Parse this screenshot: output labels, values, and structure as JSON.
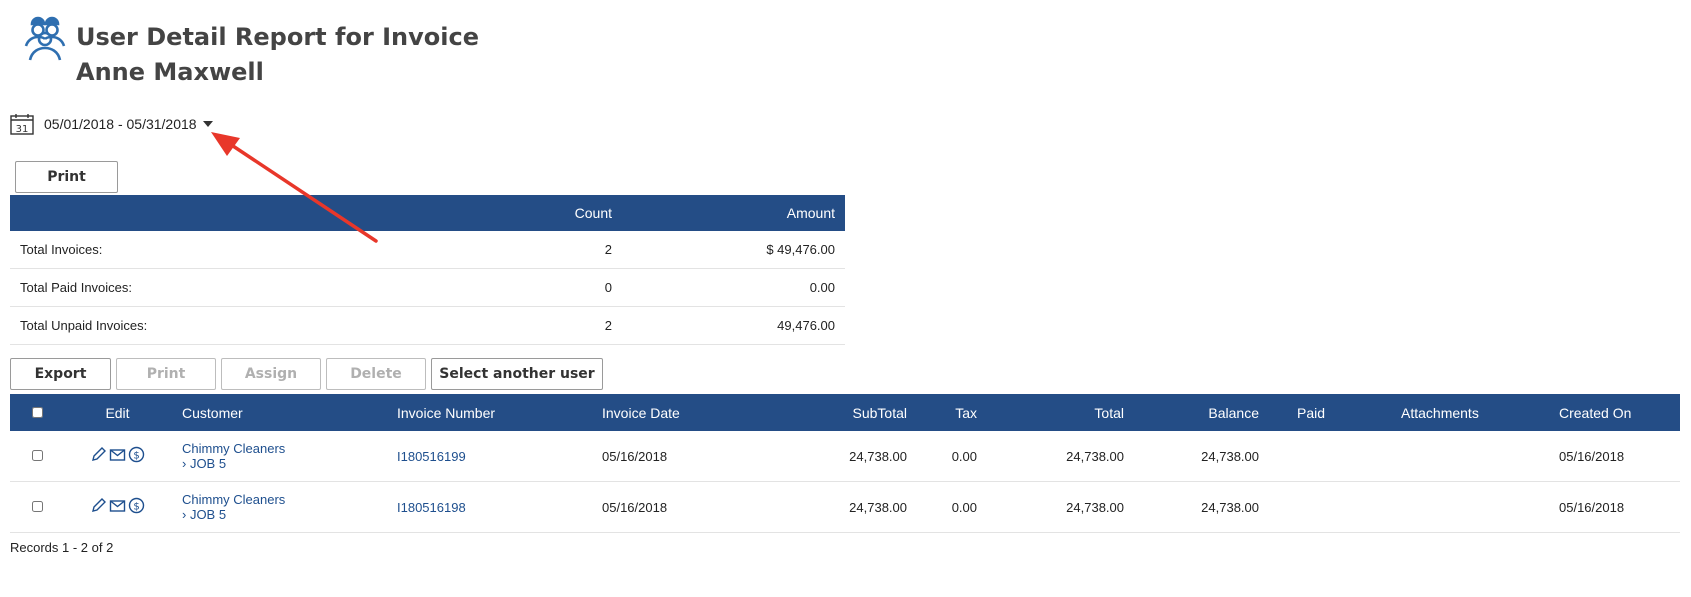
{
  "header": {
    "title": "User Detail Report for Invoice",
    "user_name": "Anne Maxwell",
    "logo_icon": "users-group-icon"
  },
  "date_range": {
    "calendar_day": "31",
    "value": "05/01/2018 - 05/31/2018"
  },
  "summary": {
    "print_label": "Print",
    "columns": [
      "",
      "Count",
      "Amount"
    ],
    "rows": [
      {
        "label": "Total Invoices:",
        "count": "2",
        "amount": "$ 49,476.00"
      },
      {
        "label": "Total Paid Invoices:",
        "count": "0",
        "amount": "0.00"
      },
      {
        "label": "Total Unpaid Invoices:",
        "count": "2",
        "amount": "49,476.00"
      }
    ]
  },
  "toolbar": {
    "export_label": "Export",
    "print_label": "Print",
    "assign_label": "Assign",
    "delete_label": "Delete",
    "select_user_label": "Select another user"
  },
  "grid": {
    "columns": [
      "Edit",
      "Customer",
      "Invoice Number",
      "Invoice Date",
      "SubTotal",
      "Tax",
      "Total",
      "Balance",
      "Paid",
      "Attachments",
      "Created On"
    ],
    "rows": [
      {
        "customer": "Chimmy Cleaners",
        "job": "› JOB 5",
        "invoice_number": "I180516199",
        "invoice_date": "05/16/2018",
        "subtotal": "24,738.00",
        "tax": "0.00",
        "total": "24,738.00",
        "balance": "24,738.00",
        "paid": "",
        "attachments": "",
        "created_on": "05/16/2018"
      },
      {
        "customer": "Chimmy Cleaners",
        "job": "› JOB 5",
        "invoice_number": "I180516198",
        "invoice_date": "05/16/2018",
        "subtotal": "24,738.00",
        "tax": "0.00",
        "total": "24,738.00",
        "balance": "24,738.00",
        "paid": "",
        "attachments": "",
        "created_on": "05/16/2018"
      }
    ]
  },
  "footer": {
    "records": "Records 1 - 2 of 2"
  },
  "colors": {
    "header_bg": "#244d86",
    "link": "#1e4f8e",
    "logo": "#2f6fb0",
    "annotation_arrow": "#e8372a"
  }
}
